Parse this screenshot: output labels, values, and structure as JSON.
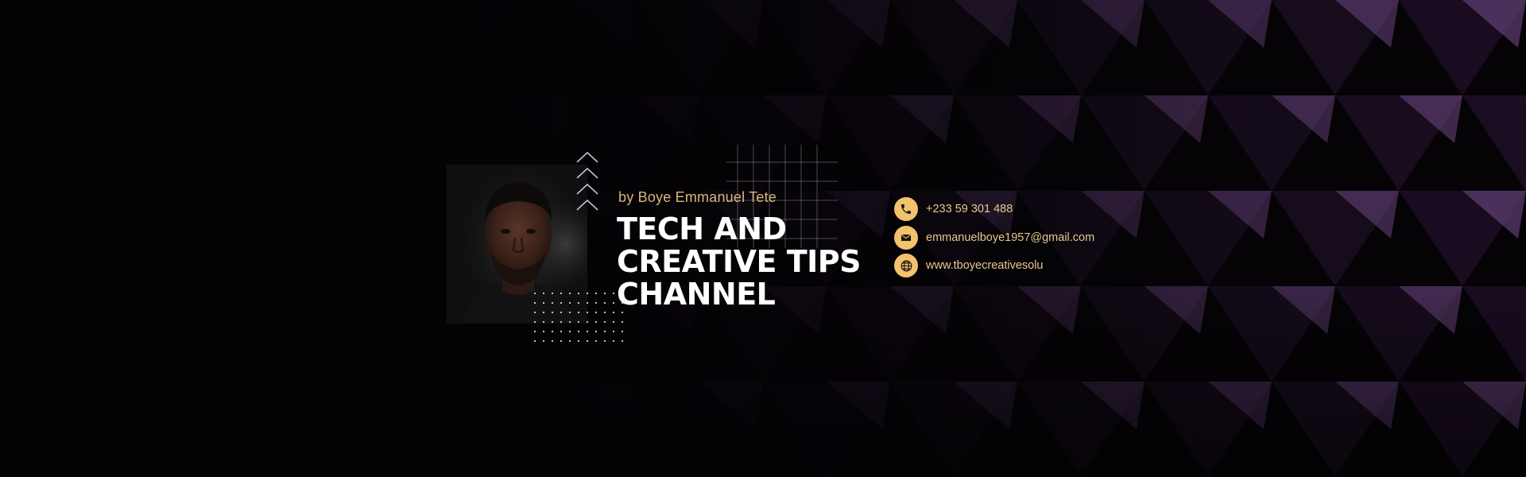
{
  "banner": {
    "byline": "by Boye Emmanuel Tete",
    "title_lines": [
      "TECH AND",
      "CREATIVE TIPS",
      "CHANNEL"
    ],
    "contacts": [
      {
        "icon": "phone-icon",
        "text": "+233 59 301 488"
      },
      {
        "icon": "mail-icon",
        "text": "emmanuelboye1957@gmail.com"
      },
      {
        "icon": "globe-icon",
        "text": "www.tboyecreativesolu"
      }
    ],
    "colors": {
      "accent": "#f2c26c",
      "byline": "#d9b67a",
      "contact_text": "#e8c88e",
      "title": "#ffffff",
      "background": "#050306",
      "pattern_purple": "#6b4a7c"
    }
  }
}
